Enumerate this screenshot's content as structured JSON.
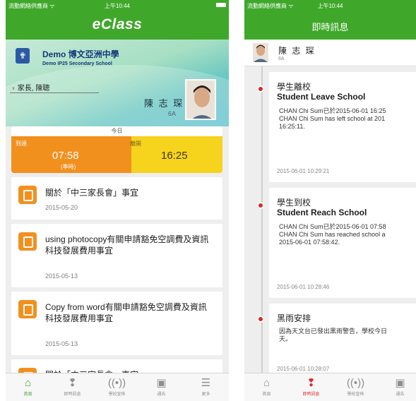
{
  "status_bar": {
    "carrier": "流動網絡供應商 ᯤ",
    "time": "上午10:44"
  },
  "left": {
    "brand": "eClass",
    "school_name": "Demo 博文亞洲中學",
    "school_sub": "Demo IP25 Secondary School",
    "parent_label": "家長, 陳聰",
    "student_name": "陳 志 琛",
    "student_class": "6A",
    "today_label": "今日",
    "arrive_label": "到達",
    "arrive_time": "07:58",
    "arrive_status": "(準時)",
    "leave_label": "離開",
    "leave_time": "16:25",
    "notices": [
      {
        "title": "關於「中三家長會」事宜",
        "date": "2015-05-20"
      },
      {
        "title": "using photocopy有關申請豁免空調費及資訊科技發展費用事宜",
        "date": "2015-05-13"
      },
      {
        "title": "Copy from word有關申請豁免空調費及資訊科技發展費用事宜",
        "date": "2015-05-13"
      },
      {
        "title": "關於「中三家長會」事宜",
        "date": ""
      }
    ],
    "tabs": [
      {
        "label": "首頁",
        "icon": "home-icon"
      },
      {
        "label": "即時訊息",
        "icon": "message-icon"
      },
      {
        "label": "學校宣佈",
        "icon": "broadcast-icon"
      },
      {
        "label": "通告",
        "icon": "notice-icon"
      },
      {
        "label": "更多",
        "icon": "menu-icon"
      }
    ]
  },
  "right": {
    "title": "即時訊息",
    "student_name": "陳 志 琛",
    "student_class": "6A",
    "messages": [
      {
        "title_zh": "學生離校",
        "title_en": "Student Leave School",
        "body": [
          "CHAN Chi Sum已於2015-06-01 16:25",
          "CHAN Chi Sum has left school at 201",
          "16:25:11."
        ],
        "date": "2015-06-01 10:29:21"
      },
      {
        "title_zh": "學生到校",
        "title_en": "Student Reach School",
        "body": [
          "CHAN Chi Sum已於2015-06-01 07:58",
          "CHAN Chi Sum has reached school a",
          "2015-06-01 07:58:42."
        ],
        "date": "2015-06-01 10:28:46"
      },
      {
        "title_zh": "黑雨安排",
        "title_en": "",
        "body": [
          "因為天文台已發出黑雨警告，學校今日",
          "天。"
        ],
        "date": "2015-06-01 10:28:07"
      }
    ],
    "tabs": [
      {
        "label": "首頁",
        "icon": "home-icon"
      },
      {
        "label": "即時訊息",
        "icon": "message-icon"
      },
      {
        "label": "學校宣佈",
        "icon": "broadcast-icon"
      },
      {
        "label": "通告",
        "icon": "notice-icon"
      }
    ]
  },
  "colors": {
    "brand_green": "#3fa82a",
    "arrive_orange": "#f2901e",
    "leave_yellow": "#f6d31d",
    "alert_red": "#e02525"
  }
}
